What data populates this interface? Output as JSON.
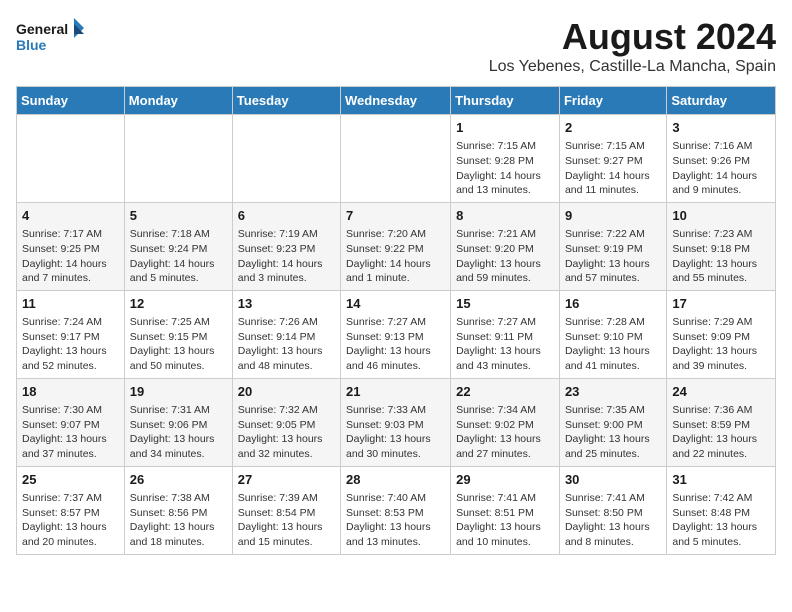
{
  "logo": {
    "line1": "General",
    "line2": "Blue"
  },
  "title": "August 2024",
  "location": "Los Yebenes, Castille-La Mancha, Spain",
  "weekdays": [
    "Sunday",
    "Monday",
    "Tuesday",
    "Wednesday",
    "Thursday",
    "Friday",
    "Saturday"
  ],
  "weeks": [
    [
      {
        "day": "",
        "content": ""
      },
      {
        "day": "",
        "content": ""
      },
      {
        "day": "",
        "content": ""
      },
      {
        "day": "",
        "content": ""
      },
      {
        "day": "1",
        "content": "Sunrise: 7:15 AM\nSunset: 9:28 PM\nDaylight: 14 hours and 13 minutes."
      },
      {
        "day": "2",
        "content": "Sunrise: 7:15 AM\nSunset: 9:27 PM\nDaylight: 14 hours and 11 minutes."
      },
      {
        "day": "3",
        "content": "Sunrise: 7:16 AM\nSunset: 9:26 PM\nDaylight: 14 hours and 9 minutes."
      }
    ],
    [
      {
        "day": "4",
        "content": "Sunrise: 7:17 AM\nSunset: 9:25 PM\nDaylight: 14 hours and 7 minutes."
      },
      {
        "day": "5",
        "content": "Sunrise: 7:18 AM\nSunset: 9:24 PM\nDaylight: 14 hours and 5 minutes."
      },
      {
        "day": "6",
        "content": "Sunrise: 7:19 AM\nSunset: 9:23 PM\nDaylight: 14 hours and 3 minutes."
      },
      {
        "day": "7",
        "content": "Sunrise: 7:20 AM\nSunset: 9:22 PM\nDaylight: 14 hours and 1 minute."
      },
      {
        "day": "8",
        "content": "Sunrise: 7:21 AM\nSunset: 9:20 PM\nDaylight: 13 hours and 59 minutes."
      },
      {
        "day": "9",
        "content": "Sunrise: 7:22 AM\nSunset: 9:19 PM\nDaylight: 13 hours and 57 minutes."
      },
      {
        "day": "10",
        "content": "Sunrise: 7:23 AM\nSunset: 9:18 PM\nDaylight: 13 hours and 55 minutes."
      }
    ],
    [
      {
        "day": "11",
        "content": "Sunrise: 7:24 AM\nSunset: 9:17 PM\nDaylight: 13 hours and 52 minutes."
      },
      {
        "day": "12",
        "content": "Sunrise: 7:25 AM\nSunset: 9:15 PM\nDaylight: 13 hours and 50 minutes."
      },
      {
        "day": "13",
        "content": "Sunrise: 7:26 AM\nSunset: 9:14 PM\nDaylight: 13 hours and 48 minutes."
      },
      {
        "day": "14",
        "content": "Sunrise: 7:27 AM\nSunset: 9:13 PM\nDaylight: 13 hours and 46 minutes."
      },
      {
        "day": "15",
        "content": "Sunrise: 7:27 AM\nSunset: 9:11 PM\nDaylight: 13 hours and 43 minutes."
      },
      {
        "day": "16",
        "content": "Sunrise: 7:28 AM\nSunset: 9:10 PM\nDaylight: 13 hours and 41 minutes."
      },
      {
        "day": "17",
        "content": "Sunrise: 7:29 AM\nSunset: 9:09 PM\nDaylight: 13 hours and 39 minutes."
      }
    ],
    [
      {
        "day": "18",
        "content": "Sunrise: 7:30 AM\nSunset: 9:07 PM\nDaylight: 13 hours and 37 minutes."
      },
      {
        "day": "19",
        "content": "Sunrise: 7:31 AM\nSunset: 9:06 PM\nDaylight: 13 hours and 34 minutes."
      },
      {
        "day": "20",
        "content": "Sunrise: 7:32 AM\nSunset: 9:05 PM\nDaylight: 13 hours and 32 minutes."
      },
      {
        "day": "21",
        "content": "Sunrise: 7:33 AM\nSunset: 9:03 PM\nDaylight: 13 hours and 30 minutes."
      },
      {
        "day": "22",
        "content": "Sunrise: 7:34 AM\nSunset: 9:02 PM\nDaylight: 13 hours and 27 minutes."
      },
      {
        "day": "23",
        "content": "Sunrise: 7:35 AM\nSunset: 9:00 PM\nDaylight: 13 hours and 25 minutes."
      },
      {
        "day": "24",
        "content": "Sunrise: 7:36 AM\nSunset: 8:59 PM\nDaylight: 13 hours and 22 minutes."
      }
    ],
    [
      {
        "day": "25",
        "content": "Sunrise: 7:37 AM\nSunset: 8:57 PM\nDaylight: 13 hours and 20 minutes."
      },
      {
        "day": "26",
        "content": "Sunrise: 7:38 AM\nSunset: 8:56 PM\nDaylight: 13 hours and 18 minutes."
      },
      {
        "day": "27",
        "content": "Sunrise: 7:39 AM\nSunset: 8:54 PM\nDaylight: 13 hours and 15 minutes."
      },
      {
        "day": "28",
        "content": "Sunrise: 7:40 AM\nSunset: 8:53 PM\nDaylight: 13 hours and 13 minutes."
      },
      {
        "day": "29",
        "content": "Sunrise: 7:41 AM\nSunset: 8:51 PM\nDaylight: 13 hours and 10 minutes."
      },
      {
        "day": "30",
        "content": "Sunrise: 7:41 AM\nSunset: 8:50 PM\nDaylight: 13 hours and 8 minutes."
      },
      {
        "day": "31",
        "content": "Sunrise: 7:42 AM\nSunset: 8:48 PM\nDaylight: 13 hours and 5 minutes."
      }
    ]
  ]
}
